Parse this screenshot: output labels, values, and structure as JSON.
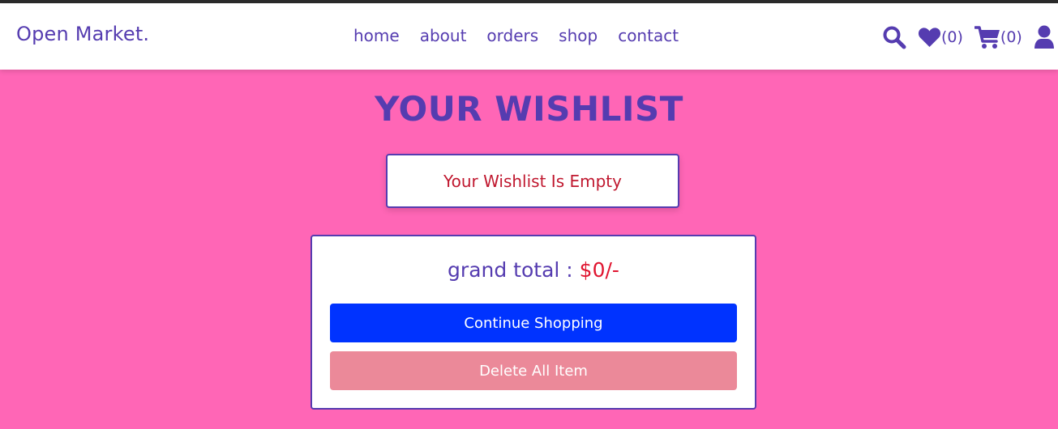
{
  "brand": {
    "logo": "Open Market."
  },
  "nav": {
    "items": [
      "home",
      "about",
      "orders",
      "shop",
      "contact"
    ]
  },
  "header_icons": {
    "wishlist_count": "(0)",
    "cart_count": "(0)",
    "icons": [
      "search-icon",
      "heart-icon",
      "cart-icon",
      "user-icon"
    ]
  },
  "page": {
    "title": "YOUR WISHLIST",
    "empty_message": "Your Wishlist Is Empty"
  },
  "summary": {
    "grand_total_label": "grand total : ",
    "grand_total_value": "$0/-",
    "continue_label": "Continue Shopping",
    "delete_label": "Delete All Item"
  },
  "colors": {
    "background": "#ff66b6",
    "accent": "#553cb0",
    "primary_button": "#0033ff",
    "danger_button_disabled": "#eb8999",
    "price": "#e0142f"
  }
}
